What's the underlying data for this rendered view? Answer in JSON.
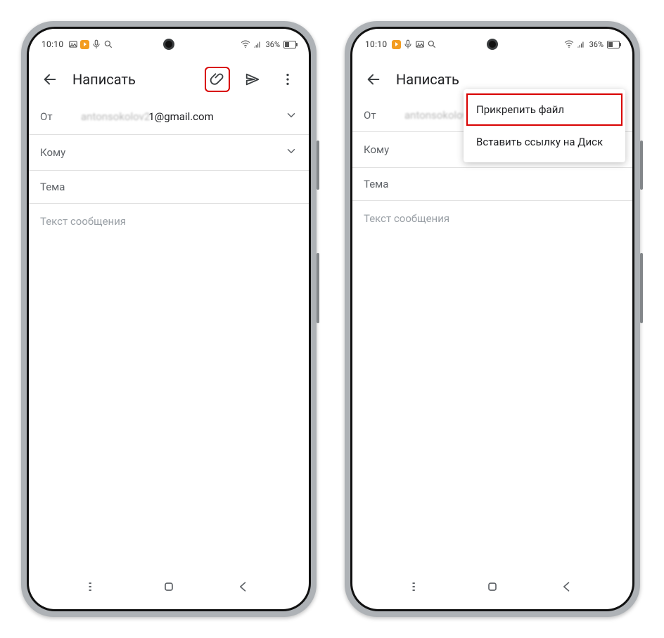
{
  "status": {
    "time": "10:10",
    "battery_text": "36%"
  },
  "compose": {
    "title": "Написать",
    "from_label": "От",
    "from_blurred": "antonsokolov2",
    "from_visible": "1@gmail.com",
    "to_label": "Кому",
    "subject_label": "Тема",
    "body_placeholder": "Текст сообщения"
  },
  "menu": {
    "attach_file": "Прикрепить файл",
    "insert_drive": "Вставить ссылку на Диск"
  }
}
